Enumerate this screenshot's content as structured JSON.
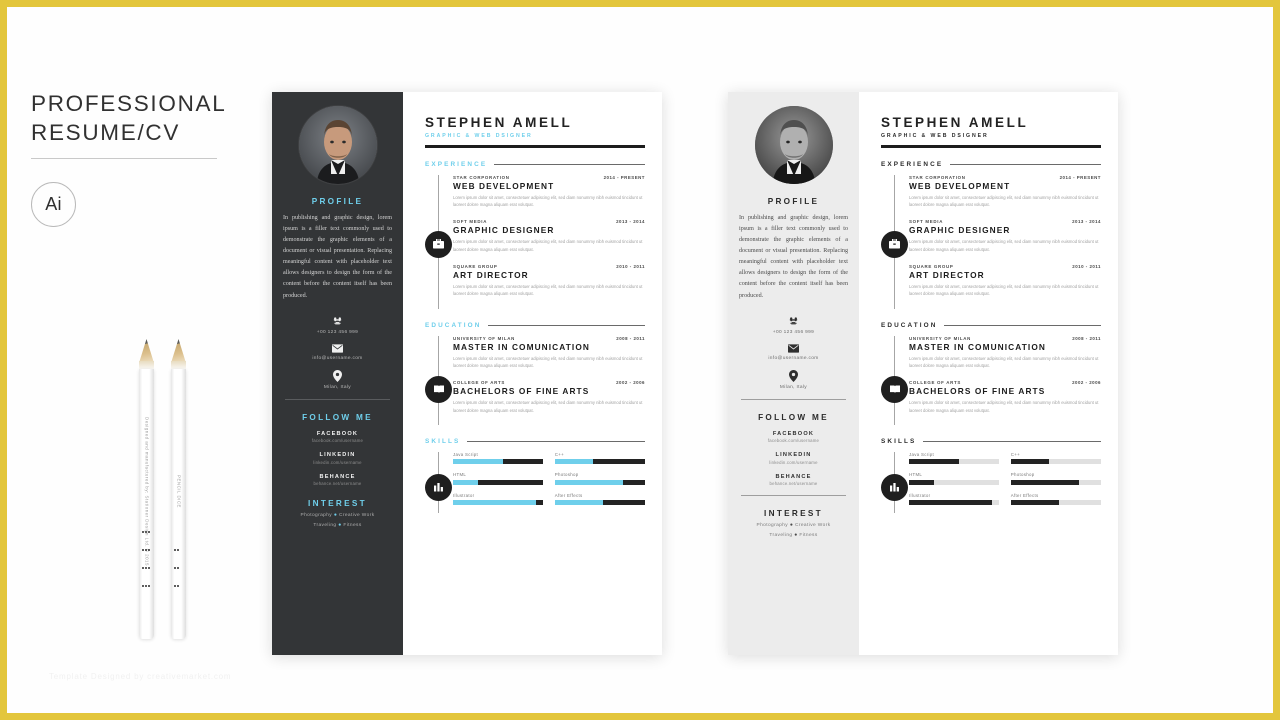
{
  "frame": {
    "accent_color": "#e3c63c"
  },
  "title": {
    "line1": "PROFESSIONAL",
    "line2": "RESUME/CV",
    "badge": "Ai"
  },
  "watermark": "Template Designed by creativemarket.com",
  "pencils": [
    {
      "vertical_text": "Designed and manufactured by: Stationer Design Ltd. © 2015"
    },
    {
      "vertical_text": "PENCIL DICE"
    }
  ],
  "colors": {
    "accent_cyan": "#6fcfeb",
    "dark_sidebar": "#333537",
    "light_sidebar": "#ececec",
    "ink": "#1c1c1c"
  },
  "resume": {
    "header": {
      "name": "STEPHEN AMELL",
      "role": "GRAPHIC & WEB DSIGNER"
    },
    "sidebar": {
      "profile_title": "PROFILE",
      "profile_text": "In publishing and graphic design, lorem ipsum is a filler text commonly used to demonstrate the graphic elements of a document or visual presentation. Replacing meaningful content with placeholder text allows designers to design the form of the content before the content itself has been produced.",
      "contact": [
        {
          "icon": "phone-icon",
          "value": "+00 123 456 999"
        },
        {
          "icon": "envelope-icon",
          "value": "info@username.com"
        },
        {
          "icon": "location-pin-icon",
          "value": "Milan, Italy"
        }
      ],
      "follow_title": "FOLLOW ME",
      "social": [
        {
          "name": "FACEBOOK",
          "url": "facebook.com/username"
        },
        {
          "name": "LINKEDIN",
          "url": "linkedin.com/username"
        },
        {
          "name": "BEHANCE",
          "url": "behance.net/username"
        }
      ],
      "interest_title": "INTEREST",
      "interests": [
        {
          "left": "Photography",
          "right": "Creative Work"
        },
        {
          "left": "Traveling",
          "right": "Fitness"
        }
      ]
    },
    "sections": {
      "experience": {
        "label": "EXPERIENCE",
        "icon": "briefcase-icon",
        "entries": [
          {
            "org": "STAR CORPORATION",
            "position": "WEB DEVELOPMENT",
            "date": "2014 - PRESENT",
            "desc": "Lorem ipsum dolor sit amet, consectetuer adipiscing elit, sed diam nonummy nibh euismod tincidunt ut laoreet dolore magna aliquam erat volutpat."
          },
          {
            "org": "SOFT MEDIA",
            "position": "GRAPHIC DESIGNER",
            "date": "2013 - 2014",
            "desc": "Lorem ipsum dolor sit amet, consectetuer adipiscing elit, sed diam nonummy nibh euismod tincidunt ut laoreet dolore magna aliquam erat volutpat."
          },
          {
            "org": "SQUARE GROUP",
            "position": "ART DIRECTOR",
            "date": "2010 - 2011",
            "desc": "Lorem ipsum dolor sit amet, consectetuer adipiscing elit, sed diam nonummy nibh euismod tincidunt ut laoreet dolore magna aliquam erat volutpat."
          }
        ]
      },
      "education": {
        "label": "EDUCATION",
        "icon": "graduation-book-icon",
        "entries": [
          {
            "org": "UNIVERSITY OF MILAN",
            "position": "MASTER IN COMUNICATION",
            "date": "2008 - 2011",
            "desc": "Lorem ipsum dolor sit amet, consectetuer adipiscing elit, sed diam nonummy nibh euismod tincidunt ut laoreet dolore magna aliquam erat volutpat."
          },
          {
            "org": "COLLEGE OF ARTS",
            "position": "BACHELORS OF FINE ARTS",
            "date": "2002 - 2006",
            "desc": "Lorem ipsum dolor sit amet, consectetuer adipiscing elit, sed diam nonummy nibh euismod tincidunt ut laoreet dolore magna aliquam erat volutpat."
          }
        ]
      },
      "skills": {
        "label": "SKILLS",
        "icon": "bar-chart-icon",
        "items": [
          {
            "name": "Java Script",
            "percent": 55
          },
          {
            "name": "C++",
            "percent": 42
          },
          {
            "name": "HTML",
            "percent": 28
          },
          {
            "name": "Photoshop",
            "percent": 76
          },
          {
            "name": "Illustrator",
            "percent": 92
          },
          {
            "name": "After Effects",
            "percent": 53
          }
        ]
      }
    }
  }
}
